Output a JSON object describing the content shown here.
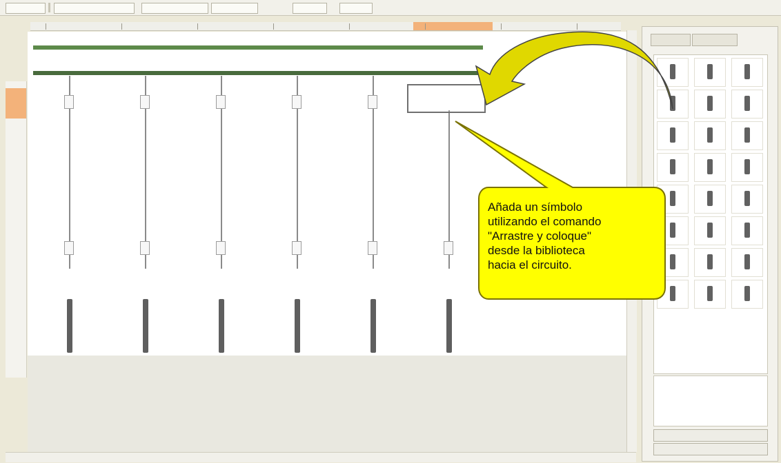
{
  "callout": {
    "lines": [
      "Añada un símbolo",
      "utilizando el comando",
      "\"Arrastre y coloque\"",
      "desde la biblioteca",
      "hacia el circuito."
    ]
  },
  "colors": {
    "busbar_top": "#5d8a4a",
    "busbar_bottom": "#496b3d",
    "callout_fill": "#ffff00",
    "callout_stroke": "#7a7200",
    "arrow_fill": "#e0d800",
    "ruler_highlight": "#f3b27a"
  },
  "icons": {
    "curved_arrow": "curved-arrow-icon",
    "library_symbols": "electrical-symbol-icon"
  }
}
